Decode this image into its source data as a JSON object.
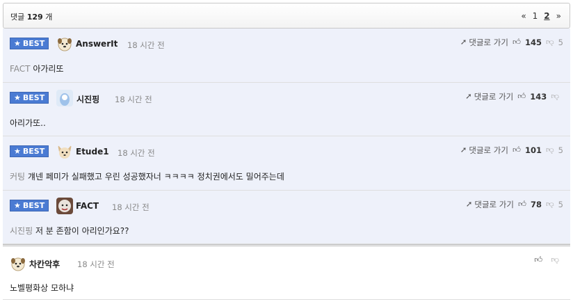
{
  "header": {
    "label": "댓글",
    "count": "129",
    "unit": "개",
    "pager": {
      "prev": "«",
      "pages": [
        "1",
        "2"
      ],
      "current_page": "2",
      "next": "»"
    }
  },
  "common": {
    "best_label": "BEST",
    "goto_label": "댓글로 가기"
  },
  "comments": [
    {
      "type": "best",
      "nick": "AnswerIt",
      "time": "18 시간 전",
      "prefix": "FACT",
      "text": "아가리또",
      "likes": "145",
      "dislikes": "5"
    },
    {
      "type": "best",
      "nick": "시진핑",
      "time": "18 시간 전",
      "prefix": "",
      "text": "아리가또..",
      "likes": "143",
      "dislikes": ""
    },
    {
      "type": "best",
      "nick": "Etude1",
      "time": "18 시간 전",
      "prefix": "커팅",
      "text": "걔넨 페미가 실패했고 우린 성공했자너 ㅋㅋㅋㅋ 정치권에서도 밀어주는데",
      "likes": "101",
      "dislikes": "5"
    },
    {
      "type": "best",
      "nick": "FACT",
      "time": "18 시간 전",
      "prefix": "시진핑",
      "text": "저 분 존함이 아리인가요??",
      "likes": "78",
      "dislikes": "5"
    },
    {
      "type": "normal",
      "nick": "차칸악후",
      "time": "18 시간 전",
      "prefix": "",
      "text": "노벨평화상 모하냐",
      "likes": "",
      "dislikes": ""
    }
  ]
}
